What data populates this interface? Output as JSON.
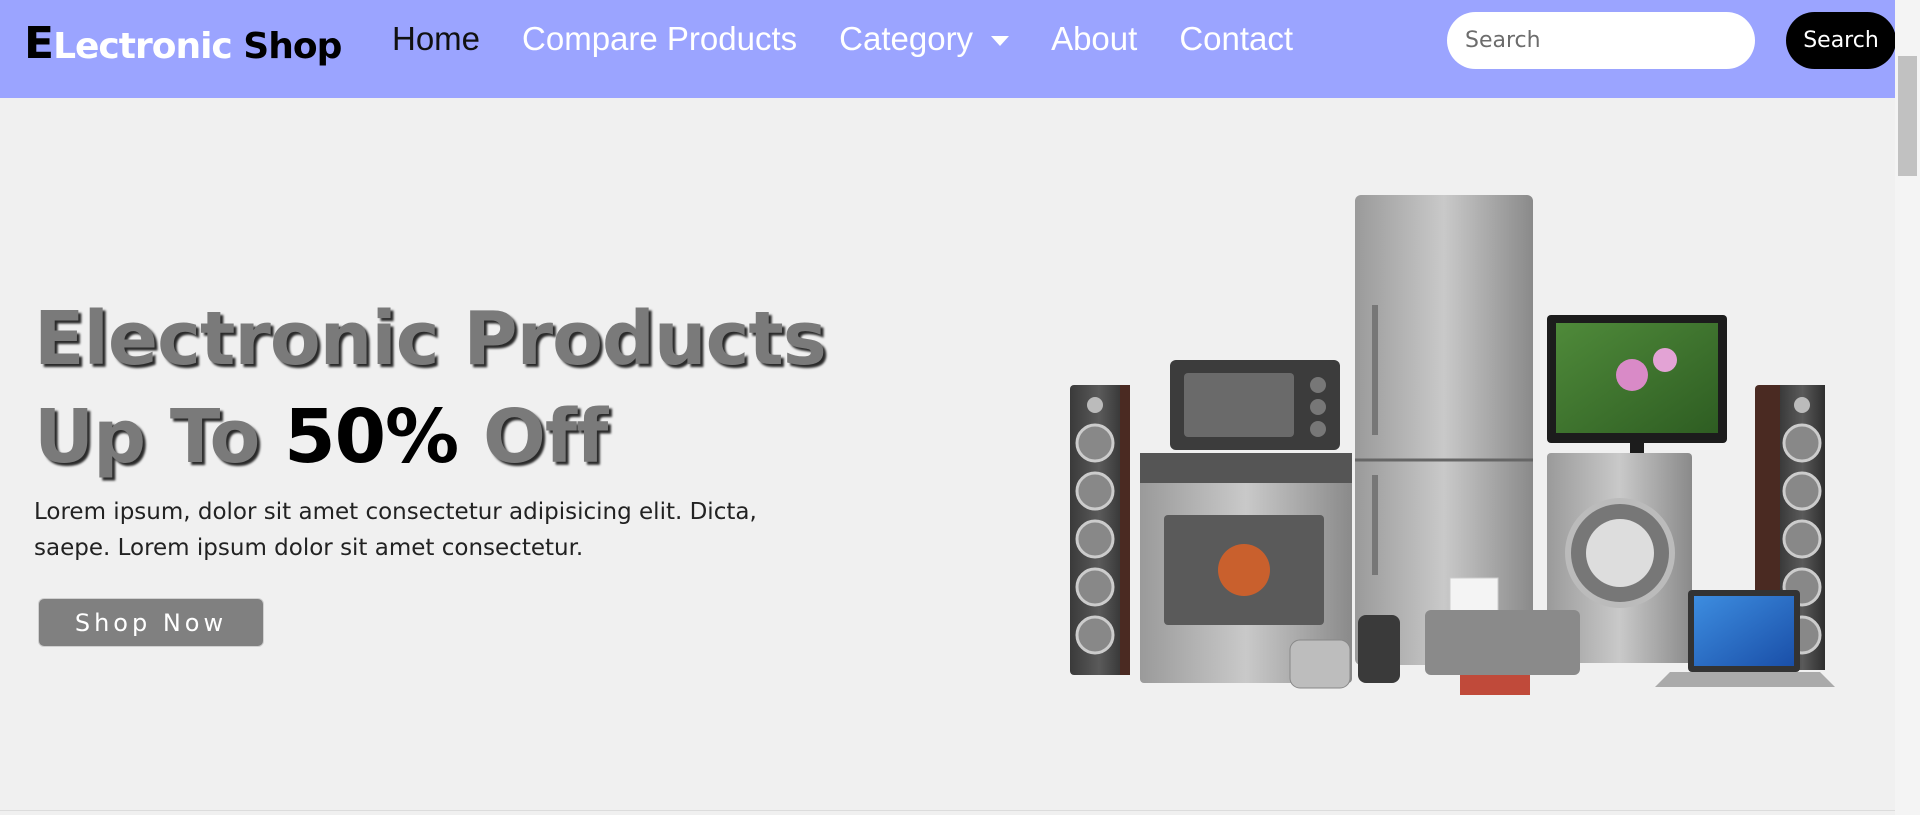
{
  "brand": {
    "first_letter": "E",
    "middle": "Lectronic",
    "tail": " Shop"
  },
  "nav": {
    "items": [
      {
        "label": "Home"
      },
      {
        "label": "Compare Products"
      },
      {
        "label": "Category"
      },
      {
        "label": "About"
      },
      {
        "label": "Contact"
      }
    ]
  },
  "search": {
    "placeholder": "Search",
    "value": "",
    "button_label": "Search"
  },
  "hero": {
    "title_line1": "Electronic Products",
    "title_line2_prefix": "Up To ",
    "title_line2_highlight": "50%",
    "title_line2_suffix": " Off",
    "description": "Lorem ipsum, dolor sit amet consectetur adipisicing elit. Dicta, saepe. Lorem ipsum dolor sit amet consectetur.",
    "button_label": "Shop Now"
  },
  "colors": {
    "navbar": "#9ba4ff",
    "background": "#f0f0f0",
    "button": "#808080"
  }
}
